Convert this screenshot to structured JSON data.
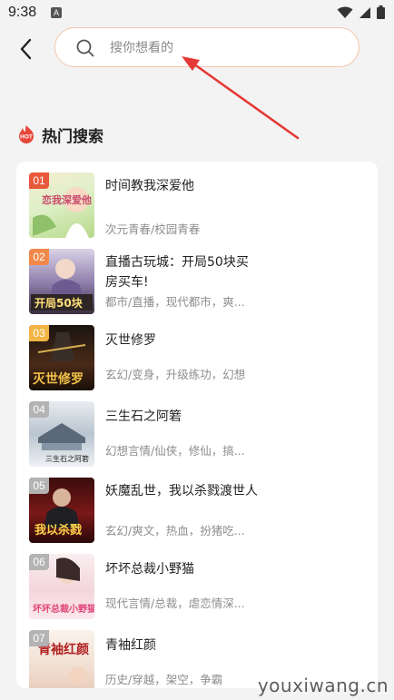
{
  "status_bar": {
    "time": "9:38",
    "notification_icon": "A"
  },
  "search": {
    "placeholder": "搜你想看的"
  },
  "section": {
    "title": "热门搜索",
    "badge": "HOT"
  },
  "books": [
    {
      "rank": "01",
      "title": "时间教我深爱他",
      "tags": "次元青春/校园青春",
      "rank_color": "#e8593c"
    },
    {
      "rank": "02",
      "title": "直播古玩城：开局50块买房买车!",
      "tags": "都市/直播，现代都市，爽...",
      "rank_color": "#f0884a"
    },
    {
      "rank": "03",
      "title": "灭世修罗",
      "tags": "玄幻/变身，升级练功，幻想",
      "rank_color": "#f2b545"
    },
    {
      "rank": "04",
      "title": "三生石之阿箬",
      "tags": "幻想言情/仙侠，修仙，搞...",
      "rank_color": "#b3b3b3"
    },
    {
      "rank": "05",
      "title": "妖魔乱世，我以杀戮渡世人",
      "tags": "玄幻/爽文，热血，扮猪吃...",
      "rank_color": "#b3b3b3"
    },
    {
      "rank": "06",
      "title": "坏坏总裁小野猫",
      "tags": "现代言情/总裁，虐恋情深...",
      "rank_color": "#b3b3b3"
    },
    {
      "rank": "07",
      "title": "青袖红颜",
      "tags": "历史/穿越，架空，争霸",
      "rank_color": "#b3b3b3"
    }
  ],
  "covers": [
    {
      "cover_text": "恋我深爱他"
    },
    {
      "cover_text": "开局50块"
    },
    {
      "cover_text": "灭世修罗"
    },
    {
      "cover_text": "三生石之阿箬"
    },
    {
      "cover_text": "我以杀戮"
    },
    {
      "cover_text": "坏坏总裁小野猫"
    },
    {
      "cover_text": "青袖红颜"
    }
  ],
  "watermark": "youxiwang.cn",
  "colors": {
    "accent": "#e8463a",
    "search_border": "#f2c6aa",
    "background": "#f3f3f3"
  }
}
